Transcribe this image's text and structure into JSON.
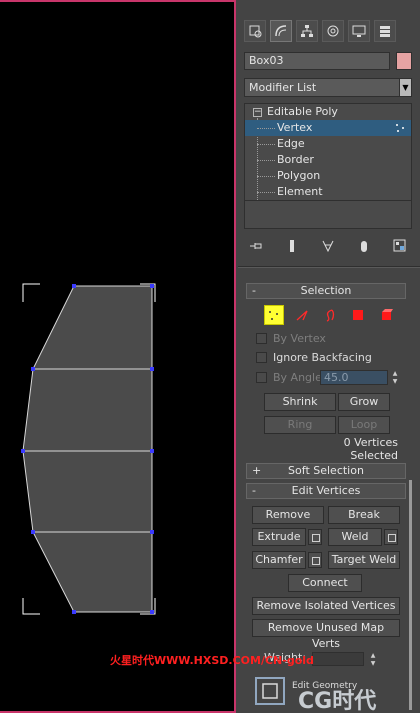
{
  "command_panel": {
    "tabs": [
      "create-icon",
      "modify-icon",
      "hierarchy-icon",
      "motion-icon",
      "display-icon",
      "utilities-icon"
    ],
    "object_name": "Box03",
    "object_color": "#e6a3a3",
    "modifier_list": "Modifier List",
    "stack": {
      "root": "Editable Poly",
      "items": [
        "Vertex",
        "Edge",
        "Border",
        "Polygon",
        "Element"
      ],
      "selected": "Vertex"
    }
  },
  "selection_rollout": {
    "sign": "-",
    "title": "Selection",
    "by_vertex": "By Vertex",
    "ignore_backfacing": "Ignore Backfacing",
    "by_angle": "By Angle:",
    "angle_value": "45.0",
    "shrink": "Shrink",
    "grow": "Grow",
    "ring": "Ring",
    "loop": "Loop",
    "status": "0 Vertices Selected"
  },
  "soft_selection_rollout": {
    "sign": "+",
    "title": "Soft Selection"
  },
  "edit_vertices_rollout": {
    "sign": "-",
    "title": "Edit Vertices",
    "remove": "Remove",
    "break": "Break",
    "extrude": "Extrude",
    "weld": "Weld",
    "chamfer": "Chamfer",
    "target_weld": "Target Weld",
    "connect": "Connect",
    "remove_isolated": "Remove Isolated Vertices",
    "remove_unused": "Remove Unused Map Verts",
    "weight": "Weight:"
  },
  "watermark": {
    "text": "火星时代WWW.HXSD.COM/CN-gold",
    "logo": "CG时代",
    "sub_caption": "Edit Geometry"
  },
  "colors": {
    "viewport_border": "#c8356a",
    "selected_row": "#2f5d80",
    "vertex_active": "#ffff33",
    "vertex_dot": "#3a3aff"
  }
}
